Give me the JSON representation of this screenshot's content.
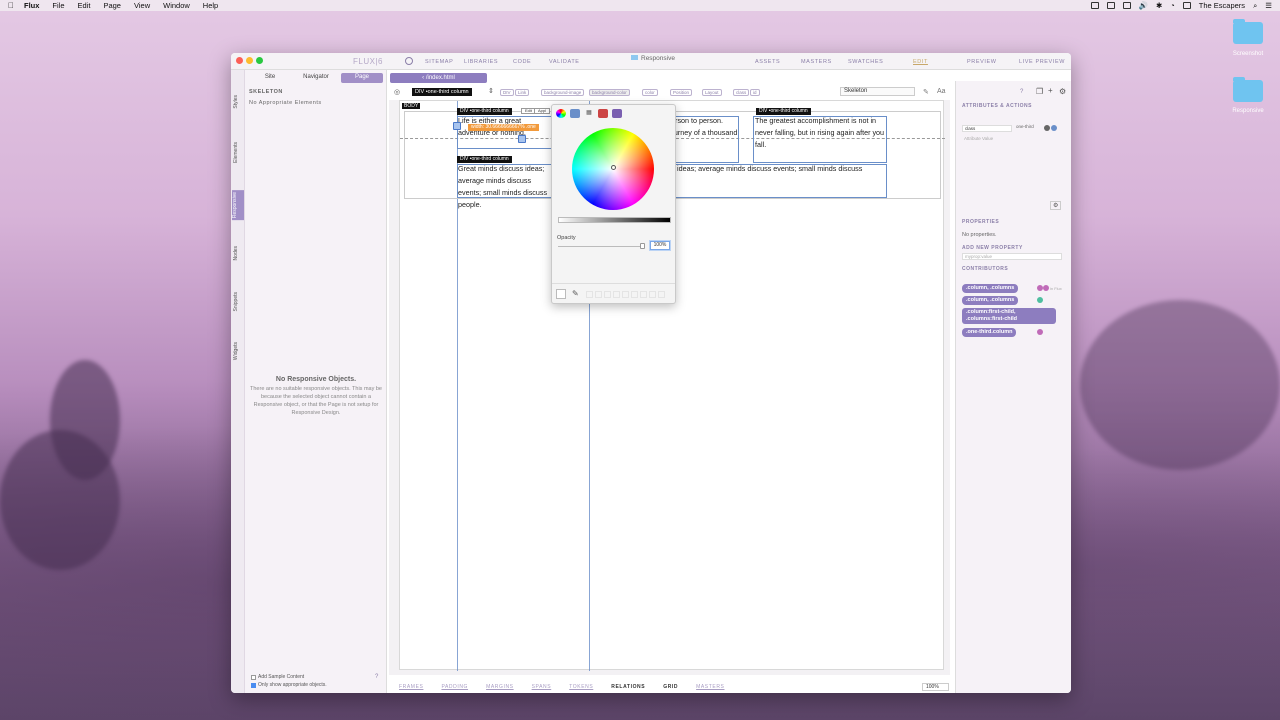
{
  "menubar": {
    "app": "Flux",
    "items": [
      "File",
      "Edit",
      "Page",
      "View",
      "Window",
      "Help"
    ],
    "user": "The Escapers"
  },
  "desktop": {
    "icons": [
      "Screenshot",
      "Responsive"
    ]
  },
  "window": {
    "brand": "FLUX|6",
    "title": "Responsive",
    "nav_left": [
      "SITEMAP",
      "LIBRARIES",
      "CODE",
      "VALIDATE"
    ],
    "nav_right": [
      "ASSETS",
      "MASTERS",
      "SWATCHES",
      "EDIT",
      "PREVIEW",
      "LIVE PREVIEW"
    ]
  },
  "left_panel": {
    "side_tabs": [
      "Styles",
      "Elements",
      "Responsive",
      "Nodes",
      "Snippets",
      "Widgets"
    ],
    "tabs": [
      "Site",
      "Navigator",
      "Page"
    ],
    "section": "SKELETON",
    "no_elements": "No Appropriate Elements",
    "empty_title": "No Responsive Objects.",
    "empty_body": "There are no suitable responsive objects. This may be because the selected object cannot contain a Responsive object, or that the Page is not setup for Responsive Design.",
    "checkbox1": "Add Sample Content",
    "checkbox2": "Only show appropriate objects."
  },
  "toolbar": {
    "doc_tab": "‹ /index.html",
    "selected": "DIV •one-third column",
    "pills": [
      "DIV",
      "Link",
      "background-image",
      "background-color",
      "color",
      "Position",
      "Layout",
      "class",
      "id"
    ],
    "skeleton_select": "Skeleton"
  },
  "canvas": {
    "body_tag": "BODY",
    "col_tag": "DIV •one-third column",
    "edit_btn": "Edit",
    "apply_btn": "Appl",
    "width_badge": "width: 30.6666666667% .one",
    "col1_text": "Life is either a great adventure or nothing.",
    "col2_text": "Do not wait for leaders; do it alone, person to person. Great things while they are small. A journey of a thousand miles begins with a single step.",
    "col3_text": "The greatest accomplishment is not in never falling, but in rising again after you fall.",
    "row2_text": "Great minds discuss ideas; average minds discuss events; small minds discuss people.",
    "row2_text_b": "ideas; average minds discuss events; small minds discuss"
  },
  "color_picker": {
    "opacity_label": "Opacity",
    "opacity_value": "100%",
    "opacity": 1.0
  },
  "right_panel": {
    "attributes_header": "ATTRIBUTES & ACTIONS",
    "attr_key": "class",
    "attr_value": "one-third",
    "attr_placeholder": "Attribute Value",
    "properties_header": "PROPERTIES",
    "no_properties": "No properties.",
    "add_property": "ADD NEW PROPERTY",
    "prop_placeholder": "myprop:value",
    "contributors_header": "CONTRIBUTORS",
    "contributors": [
      ".column, .columns",
      ".column, .columns",
      ".column:first-child, .columns:first-child",
      ".one-third.column"
    ],
    "contrib_suffix": "in  Flux"
  },
  "statusbar": {
    "items": [
      "FRAMES",
      "PADDING",
      "MARGINS",
      "SPANS",
      "TOKENS",
      "RELATIONS",
      "GRID",
      "MASTERS"
    ],
    "active": "RELATIONS",
    "zoom": "100%"
  },
  "colors": {
    "accent": "#8d7dbf",
    "guide": "#6a8fc9",
    "badge": "#f29a3c"
  }
}
